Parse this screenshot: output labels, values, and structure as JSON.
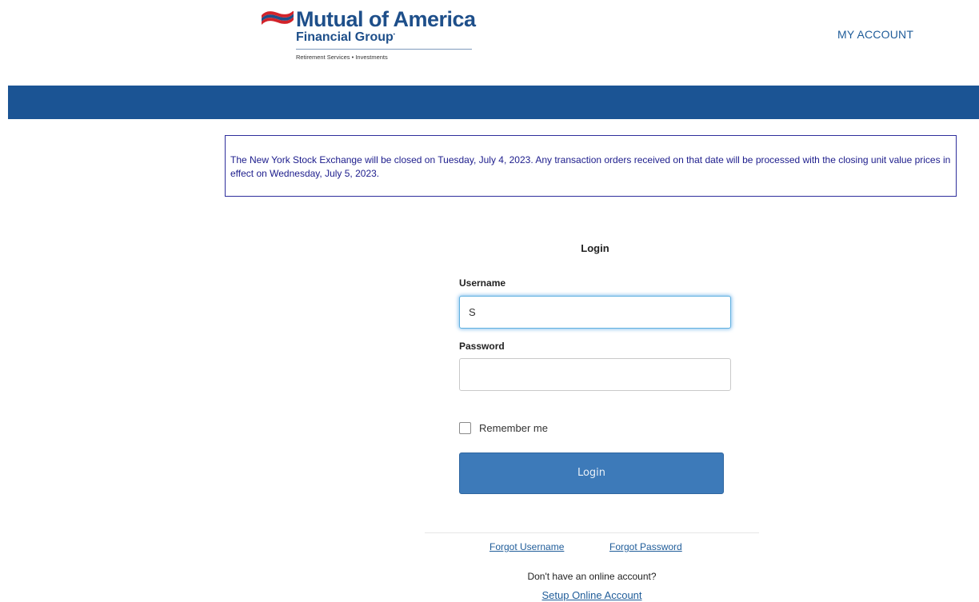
{
  "header": {
    "logo": {
      "name": "Mutual of America",
      "sub": "Financial Group",
      "tagline": "Retirement Services • Investments"
    },
    "my_account": "MY ACCOUNT"
  },
  "notice": {
    "text": "The New York Stock Exchange will be closed on Tuesday, July 4, 2023. Any transaction orders received on that date will be processed with the closing unit value prices in effect on Wednesday, July 5, 2023."
  },
  "login": {
    "title": "Login",
    "username_label": "Username",
    "username_value": "S",
    "password_label": "Password",
    "password_value": "",
    "remember_label": "Remember me",
    "remember_checked": false,
    "button_label": "Login"
  },
  "links": {
    "forgot_username": "Forgot Username",
    "forgot_password": "Forgot Password",
    "no_account": "Don't have an online account?",
    "setup": "Setup Online Account"
  },
  "colors": {
    "brand_blue": "#1b5494",
    "button_blue": "#3d7ab9",
    "link_blue": "#1f5c99",
    "notice_border": "#2e2e9c",
    "flag_red": "#d2232a"
  }
}
